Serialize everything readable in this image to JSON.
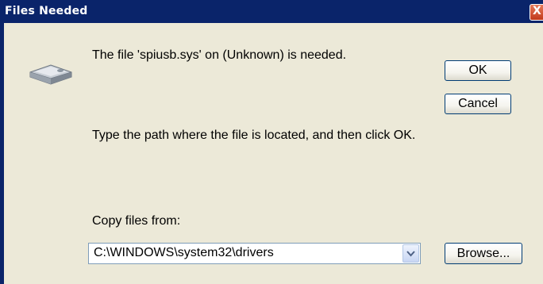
{
  "window": {
    "title": "Files Needed",
    "close_glyph": "X"
  },
  "dialog": {
    "icon": "drive-icon",
    "message_file_needed": "The file 'spiusb.sys' on (Unknown) is needed.",
    "message_instruction": "Type the path where the file is located, and then click OK.",
    "copy_files_label": "Copy files from:",
    "copy_files_value": "C:\\WINDOWS\\system32\\drivers"
  },
  "buttons": {
    "ok_label": "OK",
    "cancel_label": "Cancel",
    "browse_label": "Browse..."
  },
  "colors": {
    "titlebar": "#0a246a",
    "dialog_bg": "#ece9d8",
    "close_button": "#c0391b"
  }
}
